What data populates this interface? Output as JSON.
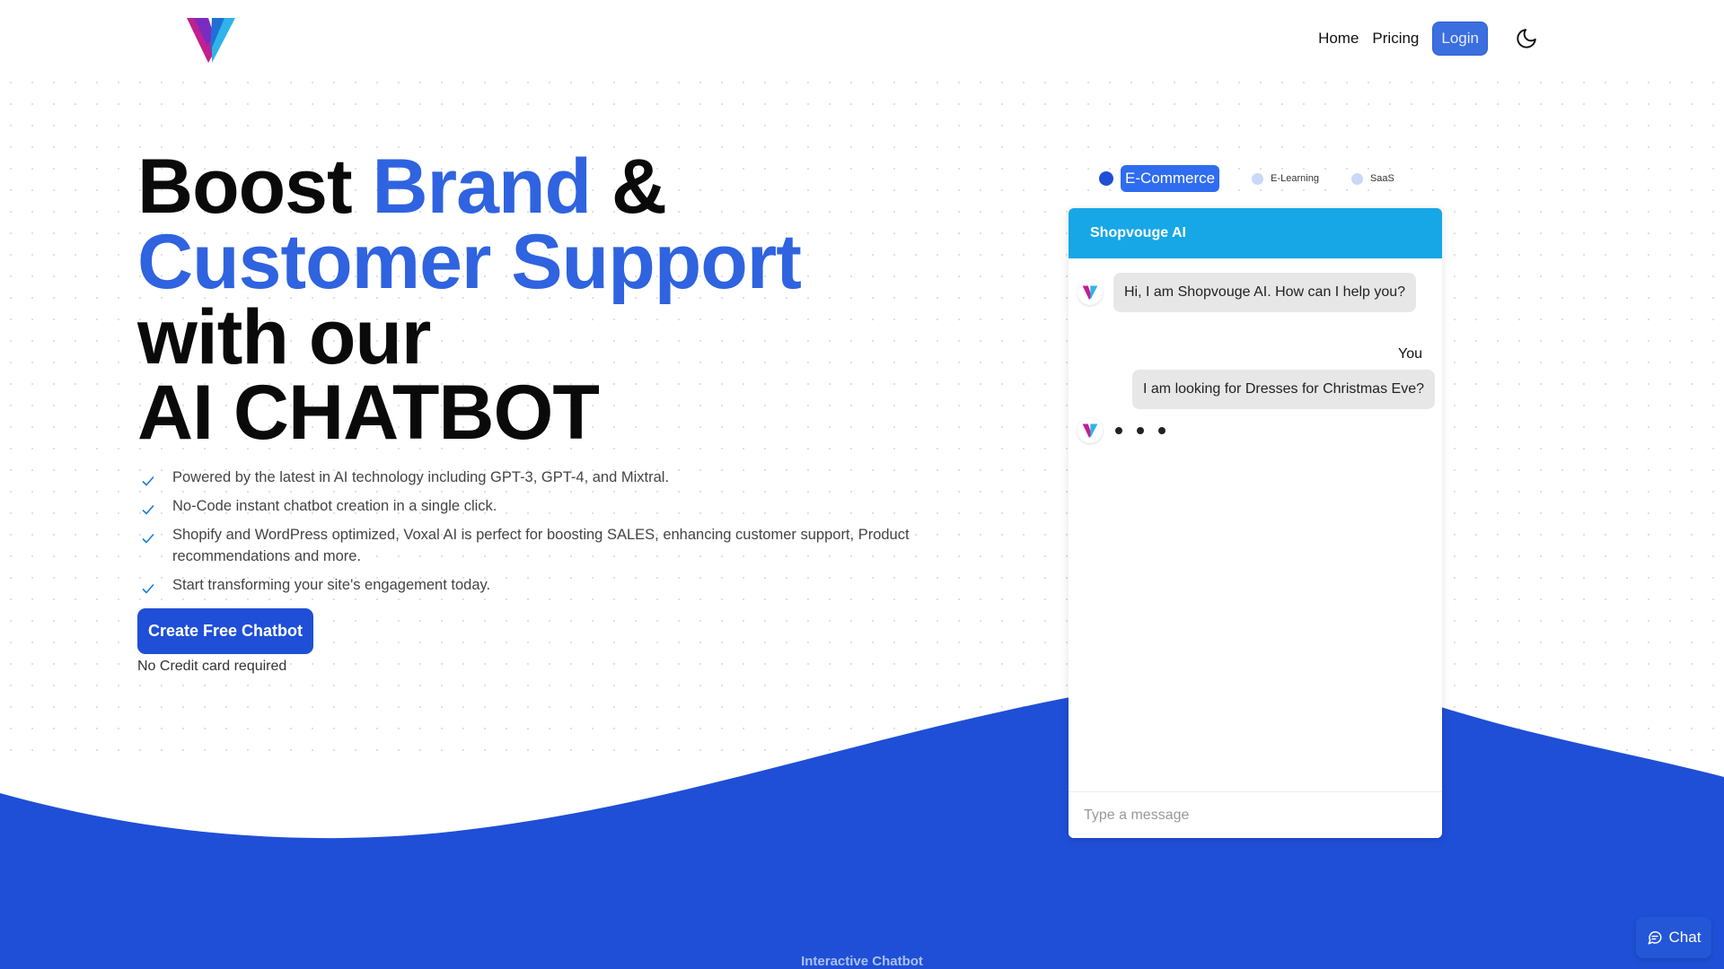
{
  "nav": {
    "home": "Home",
    "pricing": "Pricing",
    "login": "Login"
  },
  "hero": {
    "line1_a": "Boost ",
    "line1_b": "Brand",
    "line1_c": " &",
    "line2": "Customer Support",
    "line3": "with our",
    "line4": "AI CHATBOT",
    "features": [
      "Powered by the latest in AI technology including GPT-3, GPT-4, and Mixtral.",
      "No-Code instant chatbot creation in a single click.",
      "Shopify and WordPress optimized, Voxal AI is perfect for boosting SALES, enhancing customer support, Product recommendations and more.",
      "Start transforming your site's engagement today."
    ],
    "cta": "Create Free Chatbot",
    "cta_note": "No Credit card required"
  },
  "demo": {
    "tabs": [
      "E-Commerce",
      "E-Learning",
      "SaaS"
    ],
    "active_tab": "E-Commerce",
    "bot_name": "Shopvouge AI",
    "bot_message": "Hi, I am Shopvouge AI. How can I help you?",
    "user_label": "You",
    "user_message": "I am looking for Dresses for Christmas Eve?",
    "input_placeholder": "Type a message"
  },
  "section_label": "Interactive Chatbot",
  "chat_launcher": "Chat",
  "colors": {
    "brand_blue": "#1f4fd6",
    "headline_blue": "#2f63df",
    "chat_header": "#17a7e6"
  },
  "icons": {
    "logo": "voxal-logo",
    "theme": "moon-icon",
    "feature": "check-icon",
    "launcher": "chat-bubble-icon"
  }
}
